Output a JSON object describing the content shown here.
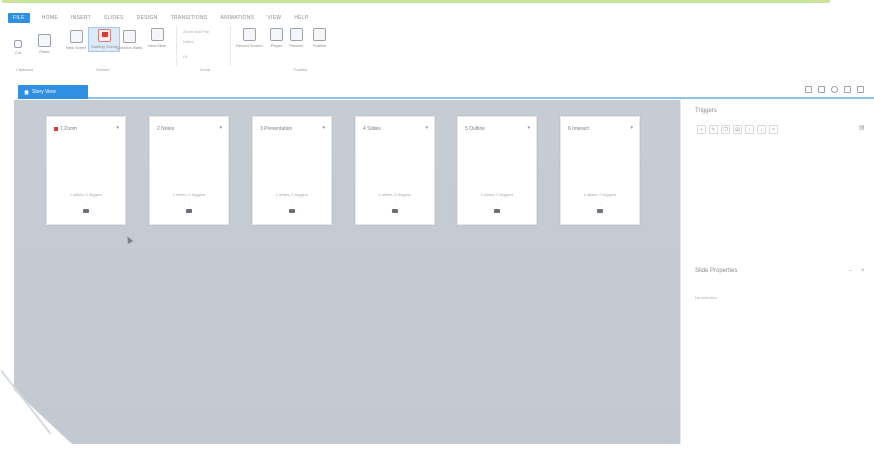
{
  "menu": {
    "tabs": [
      "FILE",
      "HOME",
      "INSERT",
      "SLIDES",
      "DESIGN",
      "TRANSITIONS",
      "ANIMATIONS",
      "VIEW",
      "HELP"
    ]
  },
  "ribbon": {
    "buttons": [
      {
        "label": "Cut"
      },
      {
        "label": "Paste"
      },
      {
        "label": "New Scene"
      },
      {
        "label": "Starting Scene"
      },
      {
        "label": "Question Bank"
      },
      {
        "label": "New Slide"
      },
      {
        "label": "Record Screen"
      },
      {
        "label": "Player"
      },
      {
        "label": "Preview"
      },
      {
        "label": "Publish"
      }
    ],
    "small_items": [
      "Zoom and Pan",
      "Notes",
      "Fit"
    ],
    "groups": [
      "Clipboard",
      "Scenes",
      "Zoom",
      "Publish"
    ]
  },
  "doc_tab": {
    "label": "Story View"
  },
  "scenes": [
    {
      "title": "1 Zoom",
      "stats": "1 slides, 0 triggers",
      "is_start": true
    },
    {
      "title": "2 Notes",
      "stats": "1 slides, 0 triggers",
      "is_start": false
    },
    {
      "title": "3 Presentation",
      "stats": "1 slides, 0 triggers",
      "is_start": false
    },
    {
      "title": "4 Slides",
      "stats": "1 slides, 0 triggers",
      "is_start": false
    },
    {
      "title": "5 Outline",
      "stats": "1 slides, 0 triggers",
      "is_start": false
    },
    {
      "title": "6 Interact",
      "stats": "1 slides, 0 triggers",
      "is_start": false
    }
  ],
  "right_panel": {
    "triggers_title": "Triggers",
    "slide_props_title": "Slide Properties",
    "slide_props_sub": "No selection"
  }
}
